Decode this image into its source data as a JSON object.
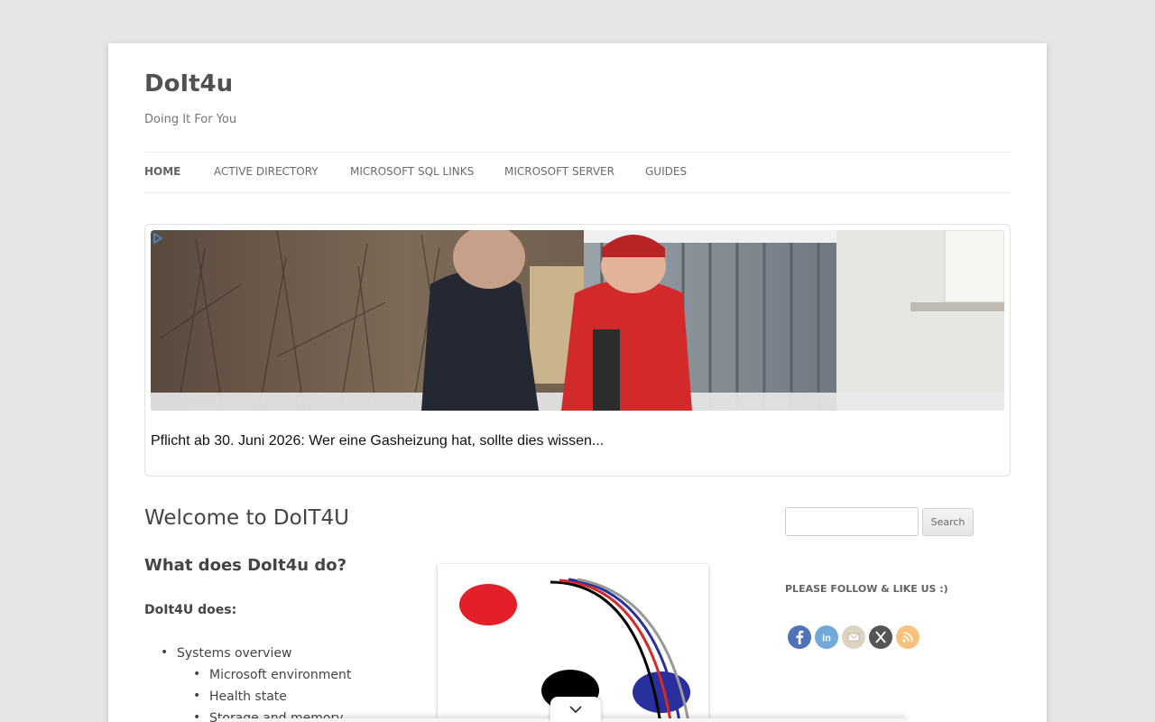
{
  "site": {
    "title": "DoIt4u",
    "description": "Doing It For You"
  },
  "nav": {
    "items": [
      {
        "label": "HOME",
        "active": true
      },
      {
        "label": "ACTIVE DIRECTORY"
      },
      {
        "label": "MICROSOFT SQL LINKS"
      },
      {
        "label": "MICROSOFT SERVER"
      },
      {
        "label": "GUIDES"
      }
    ]
  },
  "ad": {
    "headline": "Pflicht ab 30. Juni 2026: Wer eine Gasheizung hat, sollte dies wissen..."
  },
  "content": {
    "title": "Welcome to DoIT4U",
    "heading": "What does DoIt4u do?",
    "subheading": "DoIt4U does:",
    "list": {
      "item1": "Systems overview",
      "sub1": "Microsoft environment",
      "sub2": "Health state",
      "sub3": "Storage and memory"
    }
  },
  "sidebar": {
    "search_button": "Search",
    "follow_heading": "PLEASE FOLLOW & LIKE US :)",
    "social_icons": [
      "facebook-icon",
      "linkedin-icon",
      "email-icon",
      "x-icon",
      "rss-icon"
    ]
  },
  "colors": {
    "background": "#e6e6e6",
    "facebook": "#4267b2",
    "linkedin": "#3e8ec5",
    "email": "#d8cfc0",
    "x": "#444444",
    "rss": "#f7a84a"
  }
}
